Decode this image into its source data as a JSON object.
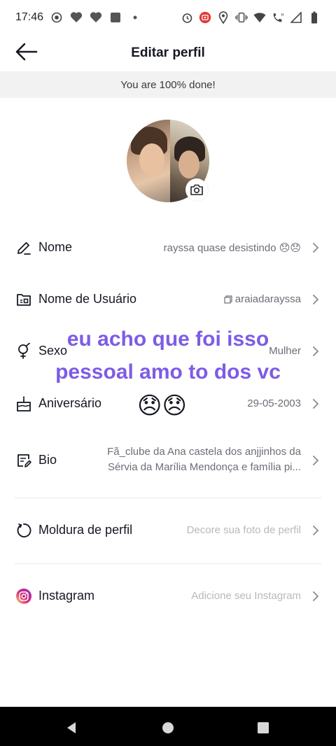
{
  "status_bar": {
    "time": "17:46"
  },
  "header": {
    "title": "Editar perfil",
    "back_icon": "arrow-left-icon"
  },
  "progress_banner": {
    "text": "You are 100% done!"
  },
  "profile_rows": {
    "nome": {
      "label": "Nome",
      "value": "rayssa quase desistindo 😞😞",
      "icon": "pencil-icon"
    },
    "usuario": {
      "label": "Nome de Usuário",
      "value": "araiadarayssa",
      "icon": "id-card-icon"
    },
    "sexo": {
      "label": "Sexo",
      "value": "Mulher",
      "icon": "gender-icon"
    },
    "aniversario": {
      "label": "Aniversário",
      "value": "29-05-2003",
      "icon": "cake-icon"
    },
    "bio": {
      "label": "Bio",
      "line1": "Fã_clube da Ana castela dos anjjinhos da",
      "line2": "Sérvia  da Marília Mendonça e família pi...",
      "icon": "edit-note-icon"
    },
    "moldura": {
      "label": "Moldura de perfil",
      "value": "Decore sua foto de perfil",
      "icon": "frame-circle-icon"
    },
    "instagram": {
      "label": "Instagram",
      "value": "Adicione seu Instagram",
      "icon": "instagram-icon"
    }
  },
  "overlay": {
    "line1": "eu acho que foi isso",
    "line2": "pessoal amo to dos vc",
    "emoji": "😞😞"
  },
  "colors": {
    "overlay_text": "#7d5ce6",
    "banner_bg": "#f2f2f2",
    "instagram_gradient": [
      "#feda75",
      "#d62976",
      "#962fbf"
    ]
  }
}
